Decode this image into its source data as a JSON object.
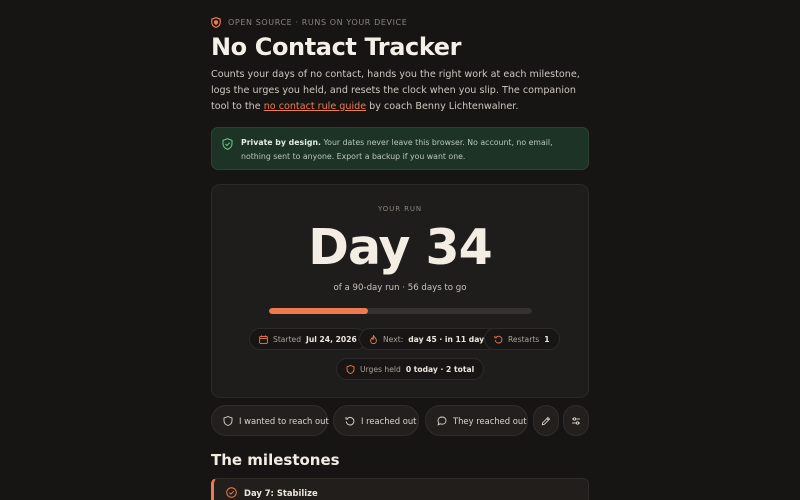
{
  "header": {
    "eyebrow": "OPEN SOURCE · RUNS ON YOUR DEVICE",
    "title": "No Contact Tracker",
    "intro_before": "Counts your days of no contact, hands you the right work at each milestone, logs the urges you held, and resets the clock when you slip. The companion tool to the ",
    "intro_link": "no contact rule guide",
    "intro_after": " by coach Benny Lichtenwalner."
  },
  "privacy": {
    "strong": "Private by design.",
    "text": " Your dates never leave this browser. No account, no email, nothing sent to anyone. Export a backup if you want one."
  },
  "run": {
    "label": "YOUR RUN",
    "day_text": "Day 34",
    "summary": "of a 90-day run · 56 days to go",
    "progress": 0.378
  },
  "stats": {
    "started_label": "Started",
    "started_value": "Jul 24, 2026",
    "next_label": "Next:",
    "next_value": "day 45 · in 11 days",
    "restarts_label": "Restarts",
    "restarts_value": "1",
    "urges_label": "Urges held",
    "urges_value": "0 today · 2 total"
  },
  "actions": {
    "reach_out": "I wanted to reach out",
    "reached_out": "I reached out",
    "they_reached": "They reached out"
  },
  "milestones": {
    "heading": "The milestones",
    "first": "Day 7: Stabilize"
  },
  "colors": {
    "accent": "#ef7a4e",
    "privacy_bg": "#1d3326",
    "privacy_icon": "#5cc489"
  }
}
